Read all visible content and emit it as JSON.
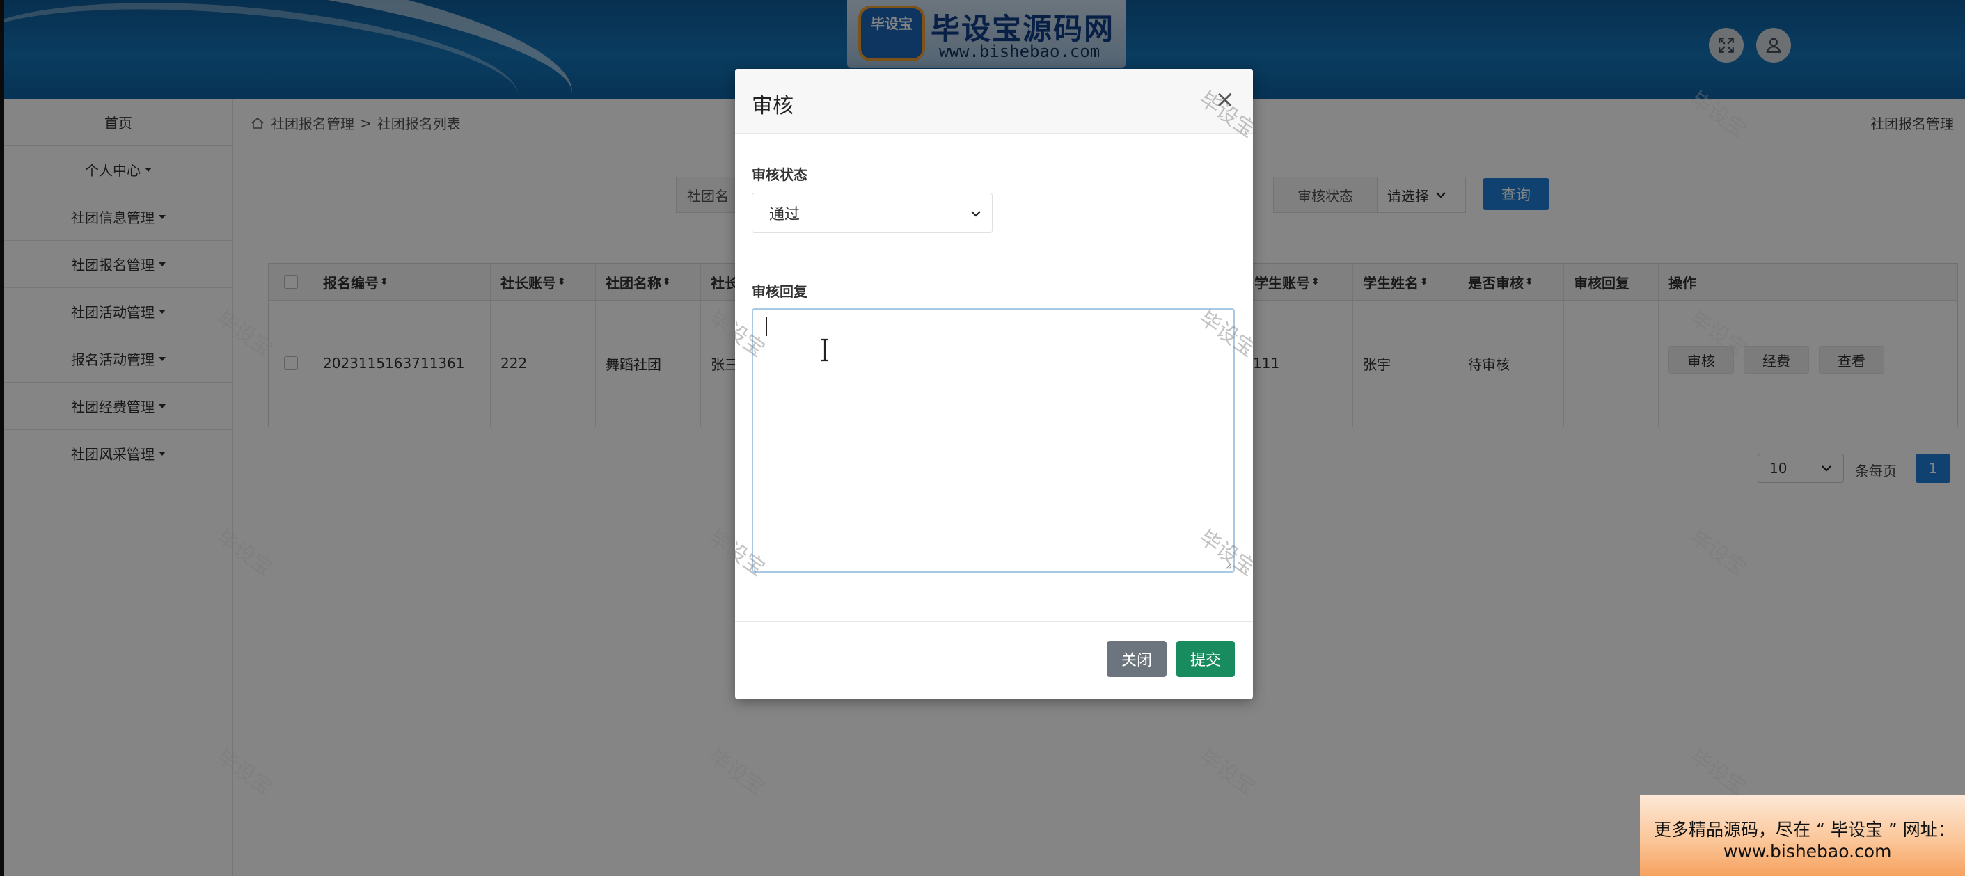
{
  "header": {
    "logo_badge": "毕设宝",
    "logo_title": "毕设宝源码网",
    "logo_url": "www.bishebao.com",
    "fullscreen_icon": "expand-icon",
    "user_icon": "user-icon"
  },
  "sidebar": {
    "items": [
      {
        "label": "首页",
        "dropdown": false
      },
      {
        "label": "个人中心",
        "dropdown": true
      },
      {
        "label": "社团信息管理",
        "dropdown": true
      },
      {
        "label": "社团报名管理",
        "dropdown": true
      },
      {
        "label": "社团活动管理",
        "dropdown": true
      },
      {
        "label": "报名活动管理",
        "dropdown": true
      },
      {
        "label": "社团经费管理",
        "dropdown": true
      },
      {
        "label": "社团风采管理",
        "dropdown": true
      }
    ]
  },
  "breadcrumb": {
    "level1": "社团报名管理",
    "separator": ">",
    "level2": "社团报名列表"
  },
  "page_title_right": "社团报名管理",
  "search": {
    "field1_label": "社团名",
    "status_label": "审核状态",
    "status_select": "请选择",
    "query_button": "查询"
  },
  "table": {
    "headers": {
      "col1": "报名编号",
      "col2": "社长账号",
      "col3": "社团名称",
      "col4": "社长",
      "col5": "学生账号",
      "col6": "学生姓名",
      "col7": "是否审核",
      "col8": "审核回复",
      "col9": "操作"
    },
    "row": {
      "col1": "2023115163711361",
      "col2": "222",
      "col3": "舞蹈社团",
      "col4": "张三",
      "col5": "111",
      "col6": "张宇",
      "col7": "待审核",
      "col8": ""
    },
    "actions": {
      "review": "审核",
      "fee": "经费",
      "view": "查看"
    }
  },
  "pagination": {
    "page_size": "10",
    "per_page_label": "条每页",
    "current_page": "1"
  },
  "modal": {
    "title": "审核",
    "close_symbol": "×",
    "status_label": "审核状态",
    "status_value": "通过",
    "reply_label": "审核回复",
    "reply_value": "",
    "close_button": "关闭",
    "submit_button": "提交"
  },
  "watermark": "毕设宝",
  "promo": {
    "line1": "更多精品源码，尽在 “ 毕设宝 ” 网址：",
    "line2": "www.bishebao.com"
  }
}
